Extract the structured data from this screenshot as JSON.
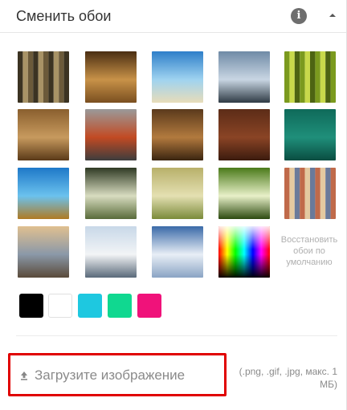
{
  "header": {
    "title": "Сменить обои",
    "info_icon": "info-icon",
    "collapse_icon": "chevron-up-icon"
  },
  "wallpapers": [
    {
      "name": "bamboo-forest",
      "colors": [
        "#3b3322",
        "#a89366",
        "#6b5a3a"
      ]
    },
    {
      "name": "wooden-perspective",
      "colors": [
        "#4a2e12",
        "#c89248",
        "#7a4f20"
      ]
    },
    {
      "name": "tropical-beach",
      "colors": [
        "#2e7fc9",
        "#9fd3f0",
        "#e8dcb9"
      ]
    },
    {
      "name": "mountain-lake",
      "colors": [
        "#6f8aa6",
        "#c9d6e3",
        "#2f3b45"
      ]
    },
    {
      "name": "green-bamboo",
      "colors": [
        "#7b9a1e",
        "#c8d94b",
        "#4d6412"
      ]
    },
    {
      "name": "old-paper",
      "colors": [
        "#8a5f2e",
        "#c79a5e",
        "#5a3a18"
      ]
    },
    {
      "name": "misty-autumn-forest",
      "colors": [
        "#9a9a9a",
        "#c24a23",
        "#3d3d3d"
      ]
    },
    {
      "name": "leather-upholstery",
      "colors": [
        "#5b3a1c",
        "#b27a3e",
        "#3a2410"
      ]
    },
    {
      "name": "dark-wood-planks",
      "colors": [
        "#5c2c17",
        "#8a4425",
        "#3b1b0e"
      ]
    },
    {
      "name": "teal-texture",
      "colors": [
        "#0f6a5a",
        "#1f8f7a",
        "#0a4d41"
      ]
    },
    {
      "name": "underwater-coral",
      "colors": [
        "#1e78c8",
        "#6bc2ee",
        "#b07a22"
      ]
    },
    {
      "name": "sunlit-forest",
      "colors": [
        "#2f3a24",
        "#d8dcc0",
        "#596b3a"
      ]
    },
    {
      "name": "wheat-grass",
      "colors": [
        "#b8b06a",
        "#e4e0b2",
        "#7a8a3a"
      ]
    },
    {
      "name": "tree-canopy",
      "colors": [
        "#4a7a1a",
        "#e8f0c8",
        "#2c4a10"
      ]
    },
    {
      "name": "colorful-stripes",
      "colors": [
        "#c06a4a",
        "#e4c9a0",
        "#6a7a9a"
      ]
    },
    {
      "name": "winter-sunset-trees",
      "colors": [
        "#e0c090",
        "#8a98a8",
        "#5a4a3a"
      ]
    },
    {
      "name": "windmill-winter",
      "colors": [
        "#c8d8e8",
        "#f2f4f6",
        "#5a6a7a"
      ]
    },
    {
      "name": "snowy-pines",
      "colors": [
        "#3a6aa8",
        "#e8eef6",
        "#8aa4c4"
      ]
    },
    {
      "name": "color-spectrum",
      "colors": [
        "#ff0000",
        "#00ff00",
        "#0000ff"
      ]
    }
  ],
  "restore_label": "Восстановить обои по умолчанию",
  "swatches": [
    {
      "name": "black",
      "color": "#000000"
    },
    {
      "name": "white",
      "color": "#ffffff"
    },
    {
      "name": "cyan",
      "color": "#1ec8e0"
    },
    {
      "name": "green",
      "color": "#10d890"
    },
    {
      "name": "pink",
      "color": "#f0127a"
    }
  ],
  "upload": {
    "label": "Загрузите изображение",
    "hint": "(.png, .gif, .jpg, макс. 1 МБ)",
    "highlight_color": "#e00000"
  }
}
